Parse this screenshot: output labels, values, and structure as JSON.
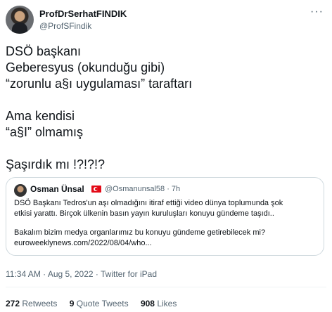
{
  "author": {
    "name": "ProfDrSerhatFINDIK",
    "handle": "@ProfSFindik"
  },
  "more_glyph": "···",
  "tweet_lines": [
    "DSÖ başkanı",
    "Geberesyus (okunduğu gibi)",
    "“zorunlu a§ı uygulaması” taraftarı",
    "",
    "Ama kendisi",
    "“a§I” olmamış",
    "",
    "Şaşırdık mı !?!?!?"
  ],
  "quoted": {
    "name": "Osman Ünsal",
    "meta": "@Osmanunsal58 · 7h",
    "lines": [
      "DSÖ Başkanı Tedros'un aşı olmadığını itiraf ettiği video dünya toplumunda şok",
      "etkisi yarattı. Birçok ülkenin basın yayın kuruluşları konuyu gündeme taşıdı..",
      "",
      "Bakalım bizim medya organlarımız bu konuyu gündeme getirebilecek mi?",
      "euroweeklynews.com/2022/08/04/who..."
    ]
  },
  "timestamp": "11:34 AM · Aug 5, 2022 · Twitter for iPad",
  "stats": {
    "retweets_count": "272",
    "retweets_label": "Retweets",
    "quotes_count": "9",
    "quotes_label": "Quote Tweets",
    "likes_count": "908",
    "likes_label": "Likes"
  }
}
